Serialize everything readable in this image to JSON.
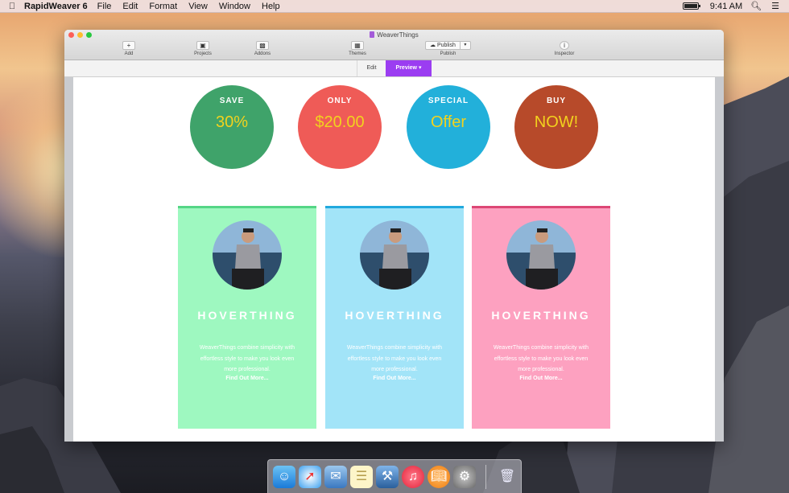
{
  "menubar": {
    "app_name": "RapidWeaver 6",
    "menus": [
      "File",
      "Edit",
      "Format",
      "View",
      "Window",
      "Help"
    ],
    "time": "9:41 AM",
    "battery_level": 1.0
  },
  "window": {
    "title": "WeaverThings",
    "toolbar": {
      "add": "Add",
      "projects": "Projects",
      "addons": "Addons",
      "themes": "Themes",
      "publish_button": "Publish",
      "publish_label": "Publish",
      "inspector": "Inspector"
    },
    "modes": {
      "edit": "Edit",
      "preview": "Preview ▾"
    }
  },
  "circles": [
    {
      "small": "SAVE",
      "big": "30%",
      "color": "#3fa36a"
    },
    {
      "small": "ONLY",
      "big": "$20.00",
      "color": "#ef5b57"
    },
    {
      "small": "SPECIAL",
      "big": "Offer",
      "color": "#22b0da"
    },
    {
      "small": "BUY",
      "big": "NOW!",
      "color": "#b74a2a"
    }
  ],
  "cards": [
    {
      "title": "HOVERTHING",
      "text": "WeaverThings combine simplicity with effortless style to make you look even more professional.",
      "link": "Find Out More...",
      "bg": "#9ef8c0",
      "accent": "#55d686"
    },
    {
      "title": "HOVERTHING",
      "text": "WeaverThings combine simplicity with effortless style to make you look even more professional.",
      "link": "Find Out More...",
      "bg": "#a2e4f8",
      "accent": "#22a9de"
    },
    {
      "title": "HOVERTHING",
      "text": "WeaverThings combine simplicity with effortless style to make you look even more professional.",
      "link": "Find Out More...",
      "bg": "#fda1c0",
      "accent": "#dd4775"
    }
  ],
  "dock": [
    "finder-icon",
    "safari-icon",
    "mail-icon",
    "notes-icon",
    "xcode-icon",
    "itunes-icon",
    "ibooks-icon",
    "system-preferences-icon",
    "trash-icon"
  ]
}
